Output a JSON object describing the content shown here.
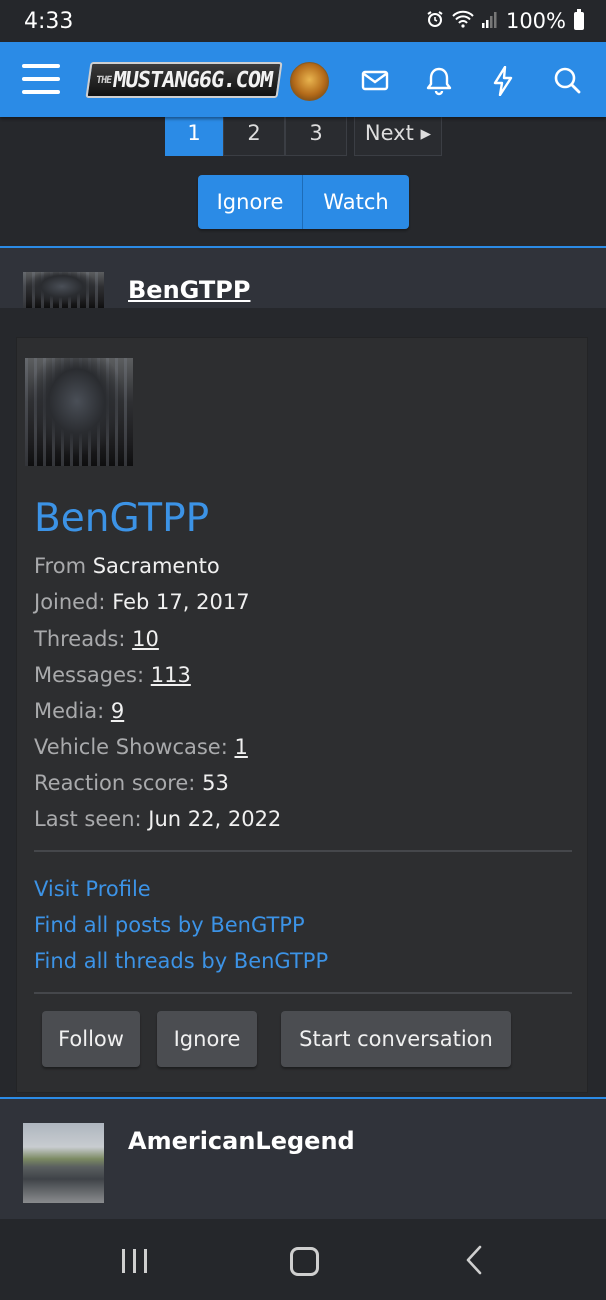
{
  "status_bar": {
    "time": "4:33",
    "battery": "100%"
  },
  "header": {
    "logo": "MUSTANG6G.COM",
    "logo_prefix": "THE"
  },
  "pagination": {
    "pages": [
      "1",
      "2",
      "3"
    ],
    "next": "Next ▸",
    "active": "1"
  },
  "thread_actions": {
    "ignore": "Ignore",
    "watch": "Watch"
  },
  "post_author": {
    "name": "BenGTPP"
  },
  "member_card": {
    "name": "BenGTPP",
    "from_label": "From",
    "from_value": "Sacramento",
    "joined_label": "Joined:",
    "joined_value": "Feb 17, 2017",
    "threads_label": "Threads:",
    "threads_value": "10",
    "messages_label": "Messages:",
    "messages_value": "113",
    "media_label": "Media:",
    "media_value": "9",
    "vehicle_label": "Vehicle Showcase:",
    "vehicle_value": "1",
    "reaction_label": "Reaction score:",
    "reaction_value": "53",
    "lastseen_label": "Last seen:",
    "lastseen_value": "Jun 22, 2022",
    "links": {
      "visit_profile": "Visit Profile",
      "find_posts": "Find all posts by BenGTPP",
      "find_threads": "Find all threads by BenGTPP"
    },
    "buttons": {
      "follow": "Follow",
      "ignore": "Ignore",
      "start_conversation": "Start conversation"
    }
  },
  "next_author": {
    "name": "AmericanLegend"
  },
  "colors": {
    "accent": "#2b8be6",
    "link": "#3c93e6",
    "background": "#26282c"
  },
  "icons": [
    "menu-icon",
    "envelope-icon",
    "bell-icon",
    "lightning-icon",
    "search-icon",
    "alarm-icon",
    "wifi-icon",
    "signal-icon"
  ]
}
